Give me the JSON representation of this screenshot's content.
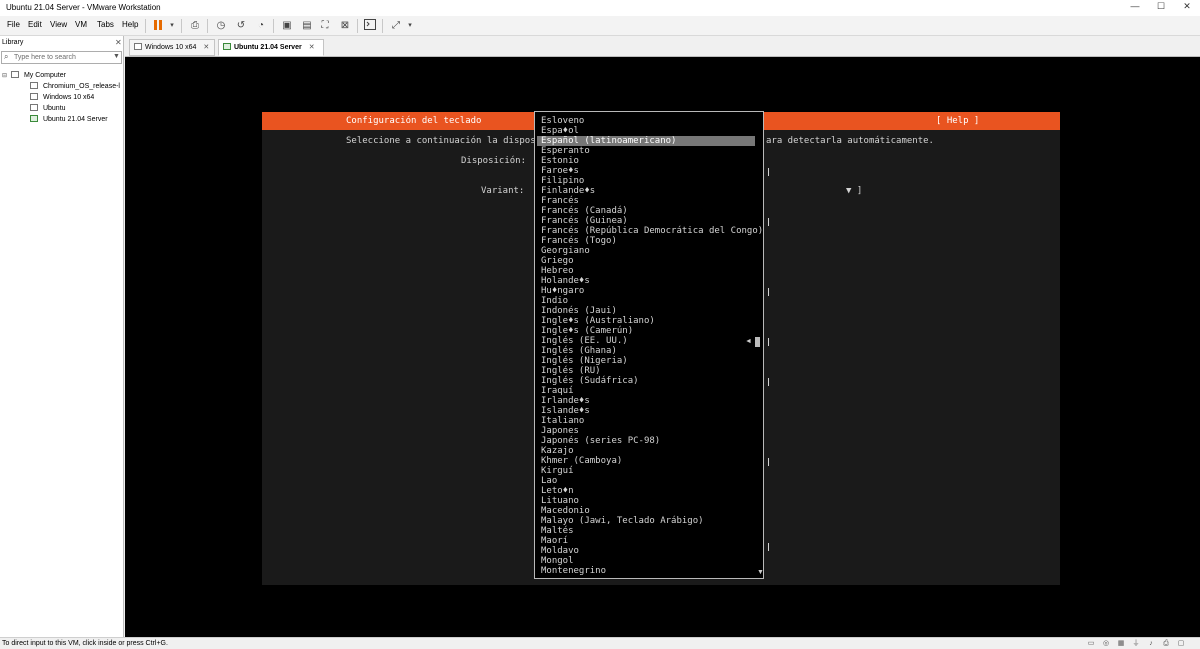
{
  "window": {
    "title": "Ubuntu 21.04 Server - VMware Workstation",
    "controls": {
      "minimize": "—",
      "maximize": "☐",
      "close": "✕"
    }
  },
  "menu": [
    "File",
    "Edit",
    "View",
    "VM",
    "Tabs",
    "Help"
  ],
  "toolbar": {
    "icons": [
      "pause-icon",
      "dropdown-arrow-icon",
      "send-ctrl-alt-del-icon",
      "snapshot-icon",
      "revert-snapshot-icon",
      "manage-snapshots-icon",
      "console-view-icon",
      "unity-view-icon",
      "fullscreen-icon",
      "stretch-icon",
      "terminal-icon",
      "autofit-icon",
      "autofit-dropdown-icon"
    ]
  },
  "library": {
    "title": "Library",
    "close": "✕",
    "search_placeholder": "Type here to search",
    "tree": [
      {
        "label": "My Computer",
        "level": 0
      },
      {
        "label": "Chromium_OS_release-l",
        "level": 1
      },
      {
        "label": "Windows 10 x64",
        "level": 1
      },
      {
        "label": "Ubuntu",
        "level": 1
      },
      {
        "label": "Ubuntu 21.04 Server",
        "level": 1,
        "running": true
      }
    ]
  },
  "tabs": [
    {
      "label": "Windows 10 x64",
      "close": "✕",
      "active": false
    },
    {
      "label": "Ubuntu 21.04 Server",
      "close": "✕",
      "active": true
    }
  ],
  "installer": {
    "header_title": "Configuración del teclado",
    "help": "[ Help ]",
    "instruction_left": "Seleccione a continuación la disposic",
    "instruction_right": "ara detectarla automáticamente.",
    "layout_label": "Disposición:",
    "variant_label": "Variant:",
    "variant_arrow": "▼ ]",
    "selected_index": 2,
    "scroll_up": "▲",
    "scroll_down": "▼",
    "scroll_marker": "◄",
    "dropdown_options": [
      "Esloveno",
      "Espa♦ol",
      "Español (latinoamericano)",
      "Esperanto",
      "Estonio",
      "Faroe♦s",
      "Filipino",
      "Finlande♦s",
      "Francés",
      "Francés (Canadá)",
      "Francés (Guinea)",
      "Francés (República Democrática del Congo)",
      "Francés (Togo)",
      "Georgiano",
      "Griego",
      "Hebreo",
      "Holande♦s",
      "Hu♦ngaro",
      "Indio",
      "Indonés (Jaui)",
      "Ingle♦s (Australiano)",
      "Ingle♦s (Camerún)",
      "Inglés (EE. UU.)",
      "Inglés (Ghana)",
      "Inglés (Nigeria)",
      "Inglés (RU)",
      "Inglés (Sudáfrica)",
      "Iraquí",
      "Irlande♦s",
      "Islande♦s",
      "Italiano",
      "Japones",
      "Japonés (series PC-98)",
      "Kazajo",
      "Khmer (Camboya)",
      "Kirguí",
      "Lao",
      "Leto♦n",
      "Lituano",
      "Macedonio",
      "Malayo (Jawi, Teclado Arábigo)",
      "Maltés",
      "Maorí",
      "Moldavo",
      "Mongol",
      "Montenegrino"
    ]
  },
  "status": {
    "message": "To direct input to this VM, click inside or press Ctrl+G.",
    "icons": [
      "hdd-icon",
      "cdrom-icon",
      "network-icon",
      "usb-icon",
      "sound-icon",
      "printer-icon",
      "display-icon"
    ]
  },
  "colors": {
    "ubuntu_orange": "#e95420",
    "installer_bg": "#1a1a1a",
    "highlight": "#777777"
  }
}
